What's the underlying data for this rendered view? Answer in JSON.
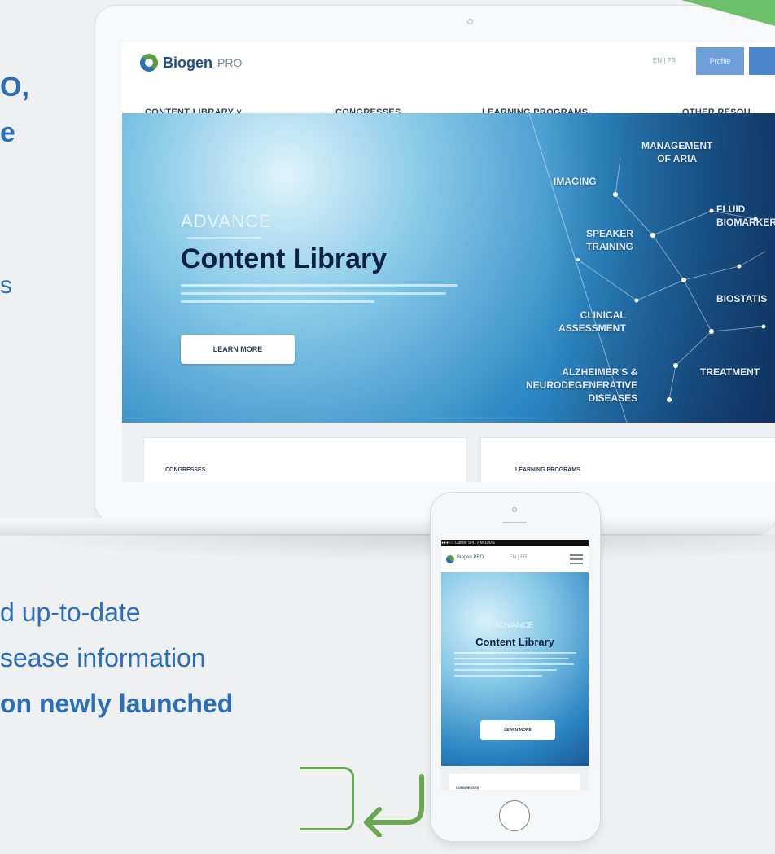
{
  "marketing": {
    "line1": "O,",
    "line2": "e",
    "line3": "s",
    "line4": "d up-to-date",
    "line5": "sease information",
    "line6": "on newly launched"
  },
  "colors": {
    "brand_blue": "#2b6fb8",
    "accent_green": "#6aa84f",
    "hero_dark": "#0d2240"
  },
  "laptop_site": {
    "logo": {
      "brand": "Biogen",
      "suffix": "PRO"
    },
    "lang_switch": "EN | FR",
    "profile_label": "Profile",
    "nav": [
      {
        "label": "CONTENT LIBRARY ˅"
      },
      {
        "label": "CONGRESSES"
      },
      {
        "label": "LEARNING PROGRAMS"
      },
      {
        "label": "OTHER RESOU"
      }
    ],
    "hero": {
      "brand_mark": "ADVANCE",
      "title": "Content Library",
      "button": "LEARN MORE",
      "topics": [
        "MANAGEMENT\nOF ARIA",
        "IMAGING",
        "FLUID\nBIOMARKER",
        "SPEAKER\nTRAINING",
        "BIOSTATIS",
        "CLINICAL\nASSESSMENT",
        "ALZHEIMER'S &\nNEURODEGENERATIVE\nDISEASES",
        "TREATMENT"
      ]
    },
    "cards": [
      {
        "title": "CONGRESSES"
      },
      {
        "title": "LEARNING PROGRAMS"
      }
    ]
  },
  "phone_site": {
    "status_bar": "●●●○○ Carrier  9:41 PM  100%",
    "logo_text": "Biogen PRO",
    "lang_switch": "EN | FR",
    "brand_mark": "ADVANCE",
    "title": "Content Library",
    "button": "LEARN MORE",
    "card_title": "CONGRESSES"
  }
}
